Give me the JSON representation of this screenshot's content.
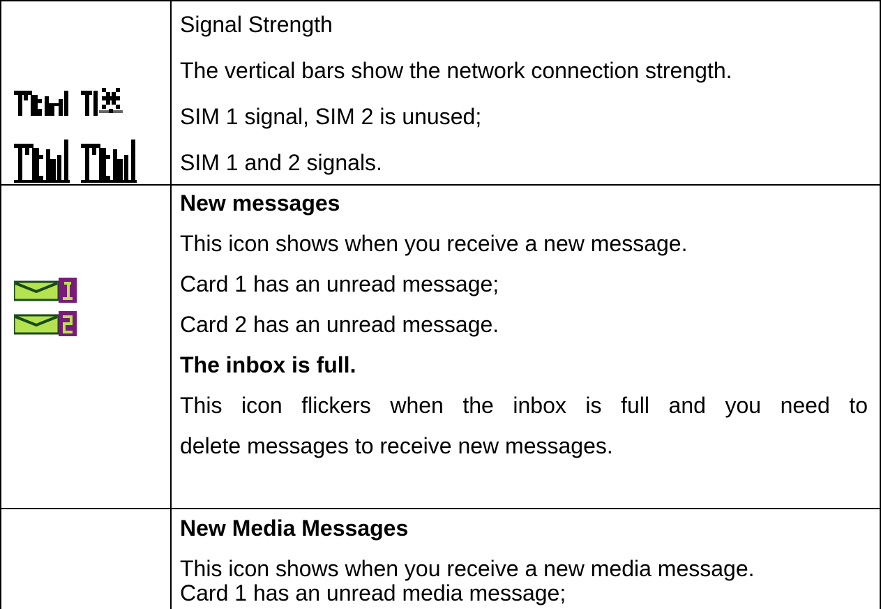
{
  "rows": [
    {
      "icons": [
        "signal-sim1-icon",
        "signal-sim2-icon"
      ],
      "lines": [
        "Signal Strength",
        "The vertical bars show the network connection strength.",
        "SIM 1 signal, SIM 2 is unused;",
        "SIM 1 and 2 signals."
      ]
    },
    {
      "icons": [
        "new-message-card1-icon",
        "new-message-card2-icon"
      ],
      "lines": [
        "New messages",
        "This icon shows when you receive a new message.",
        "Card 1 has an unread message;",
        "Card 2 has an unread message.",
        "The inbox is full.",
        "This icon flickers when the inbox is full and you need to",
        "delete messages to receive new messages."
      ]
    },
    {
      "icons": [],
      "lines": [
        "New Media Messages",
        "This icon shows when you receive a new media message.",
        "Card 1 has an unread media message;"
      ]
    }
  ],
  "colors": {
    "envelope_green": "#b5e34f",
    "envelope_dark": "#1a4a1a",
    "badge_purple": "#7a1a7a"
  }
}
